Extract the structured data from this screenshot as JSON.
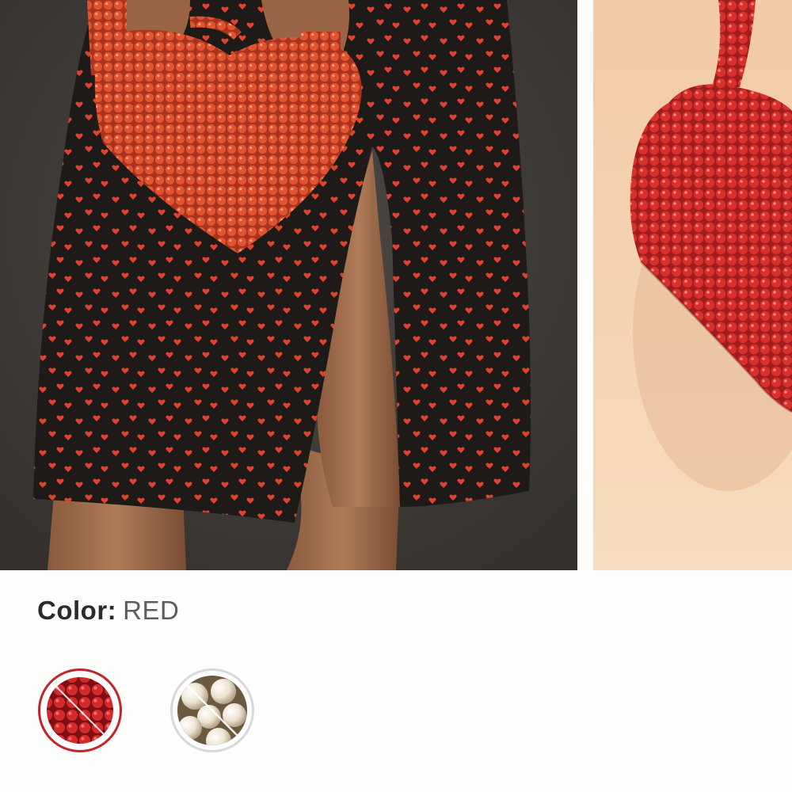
{
  "product": {
    "color_label": "Color:",
    "color_value": "RED"
  },
  "gallery": {
    "images": [
      {
        "name": "model-holding-beaded-heart-bag",
        "icon": "photo"
      },
      {
        "name": "beaded-heart-bag-on-peach-wall",
        "icon": "photo"
      }
    ]
  },
  "swatches": [
    {
      "name": "red",
      "selected": true,
      "unavailable": true,
      "color": "#c3242a"
    },
    {
      "name": "pearl",
      "selected": false,
      "unavailable": true,
      "color": "#f2ece0"
    }
  ],
  "colors": {
    "accent_red": "#c3242a",
    "text": "#2a2b31",
    "muted_text": "#5a5d63",
    "background": "#fdfdfb"
  }
}
